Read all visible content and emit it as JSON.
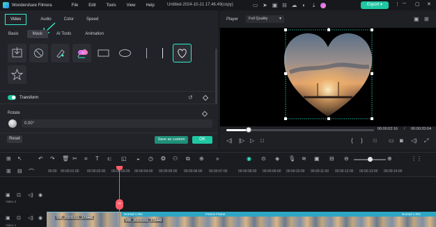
{
  "app": {
    "name": "Wondershare Filmora",
    "menu": [
      "File",
      "Edit",
      "Tools",
      "View",
      "Help"
    ],
    "document_title": "Untitled-2024-10-21 17.46.49(copy)",
    "export_label": "Export",
    "export_chevron": "▾",
    "accent_color": "#20c7a3"
  },
  "left_panel": {
    "main_tabs": [
      "Video",
      "Audio",
      "Color",
      "Speed"
    ],
    "active_main_tab": "Video",
    "sub_tabs": [
      "Basic",
      "Mask",
      "AI Tools",
      "Animation"
    ],
    "active_sub_tab": "Mask",
    "ai_badge": "AI",
    "mask_shapes": [
      {
        "name": "import-mask",
        "icon": "import-icon"
      },
      {
        "name": "no-mask",
        "icon": "none-icon"
      },
      {
        "name": "pen",
        "icon": "pen-icon"
      },
      {
        "name": "ai-brush",
        "icon": "brush-icon"
      },
      {
        "name": "rectangle",
        "icon": "rectangle-icon"
      },
      {
        "name": "ellipse",
        "icon": "ellipse-icon"
      },
      {
        "name": "single-line",
        "icon": "line-icon"
      },
      {
        "name": "double-line",
        "icon": "double-line-icon"
      },
      {
        "name": "heart",
        "icon": "heart-icon"
      },
      {
        "name": "star",
        "icon": "star-icon"
      }
    ],
    "selected_mask": "heart",
    "transform": {
      "label": "Transform",
      "enabled": true
    },
    "rotate": {
      "label": "Rotate",
      "value": "0.00°"
    },
    "reset_label": "Reset",
    "save_custom_label": "Save as custom",
    "ok_label": "OK"
  },
  "player": {
    "label": "Player",
    "quality": "Full Quality",
    "current_time": "00:00:02:16",
    "total_time": "00:00:20:04",
    "time_separator": "/",
    "progress": 0.15
  },
  "timeline": {
    "ruler_ticks": [
      "00:00",
      "00:00:01:00",
      "00:00:02:00",
      "00:00:03:00",
      "00:00:04:00",
      "00:00:05:00",
      "00:00:06:00",
      "00:00:07:00",
      "00:00:08:00",
      "00:00:09:00",
      "00:00:10:00",
      "00:00:11:00",
      "00:00:12:00",
      "00:00:13:00",
      "00:00:14:00"
    ],
    "tracks": [
      {
        "name": "Video 2"
      },
      {
        "name": "Video 1"
      }
    ],
    "clip_bottom_label": "VID_20231011_172445",
    "clip_top_label": "VID_20231011_172445",
    "overlay_left": "Normal 1.00x",
    "overlay_center": "Freeze Frame",
    "overlay_right": "Normal 1.00x",
    "playhead_marker": "✂"
  }
}
